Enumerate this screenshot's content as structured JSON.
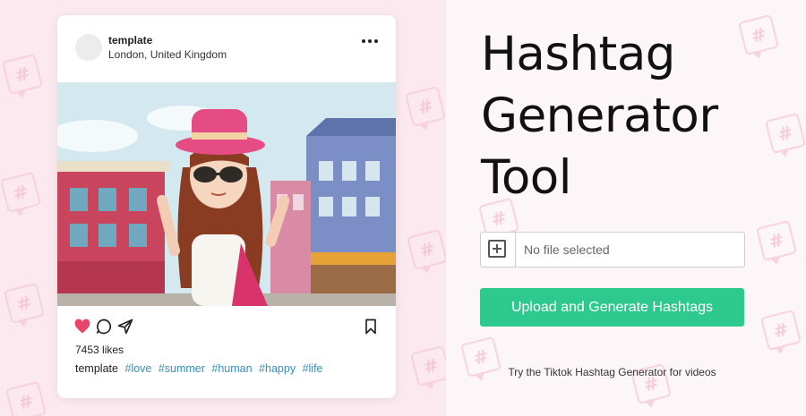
{
  "post": {
    "username": "template",
    "location": "London, United Kingdom",
    "likes": "7453 likes",
    "caption_user": "template",
    "hashtags": [
      "#love",
      "#summer",
      "#human",
      "#happy",
      "#life"
    ]
  },
  "tool": {
    "title_lines": [
      "Hashtag",
      "Generator",
      "Tool"
    ],
    "file_placeholder": "No file selected",
    "upload_button_label": "Upload and Generate Hashtags",
    "tiktok_link_text": "Try the Tiktok Hashtag Generator for videos"
  },
  "colors": {
    "accent_green": "#2dc98e",
    "heart_pink": "#e8456b",
    "hashtag_blue": "#3a8fb7",
    "background_pink": "#fbe9ef"
  },
  "icons": {
    "like": "heart-icon",
    "comment": "comment-icon",
    "share": "send-icon",
    "save": "bookmark-icon",
    "more": "more-dots-icon",
    "file": "plus-square-icon"
  }
}
